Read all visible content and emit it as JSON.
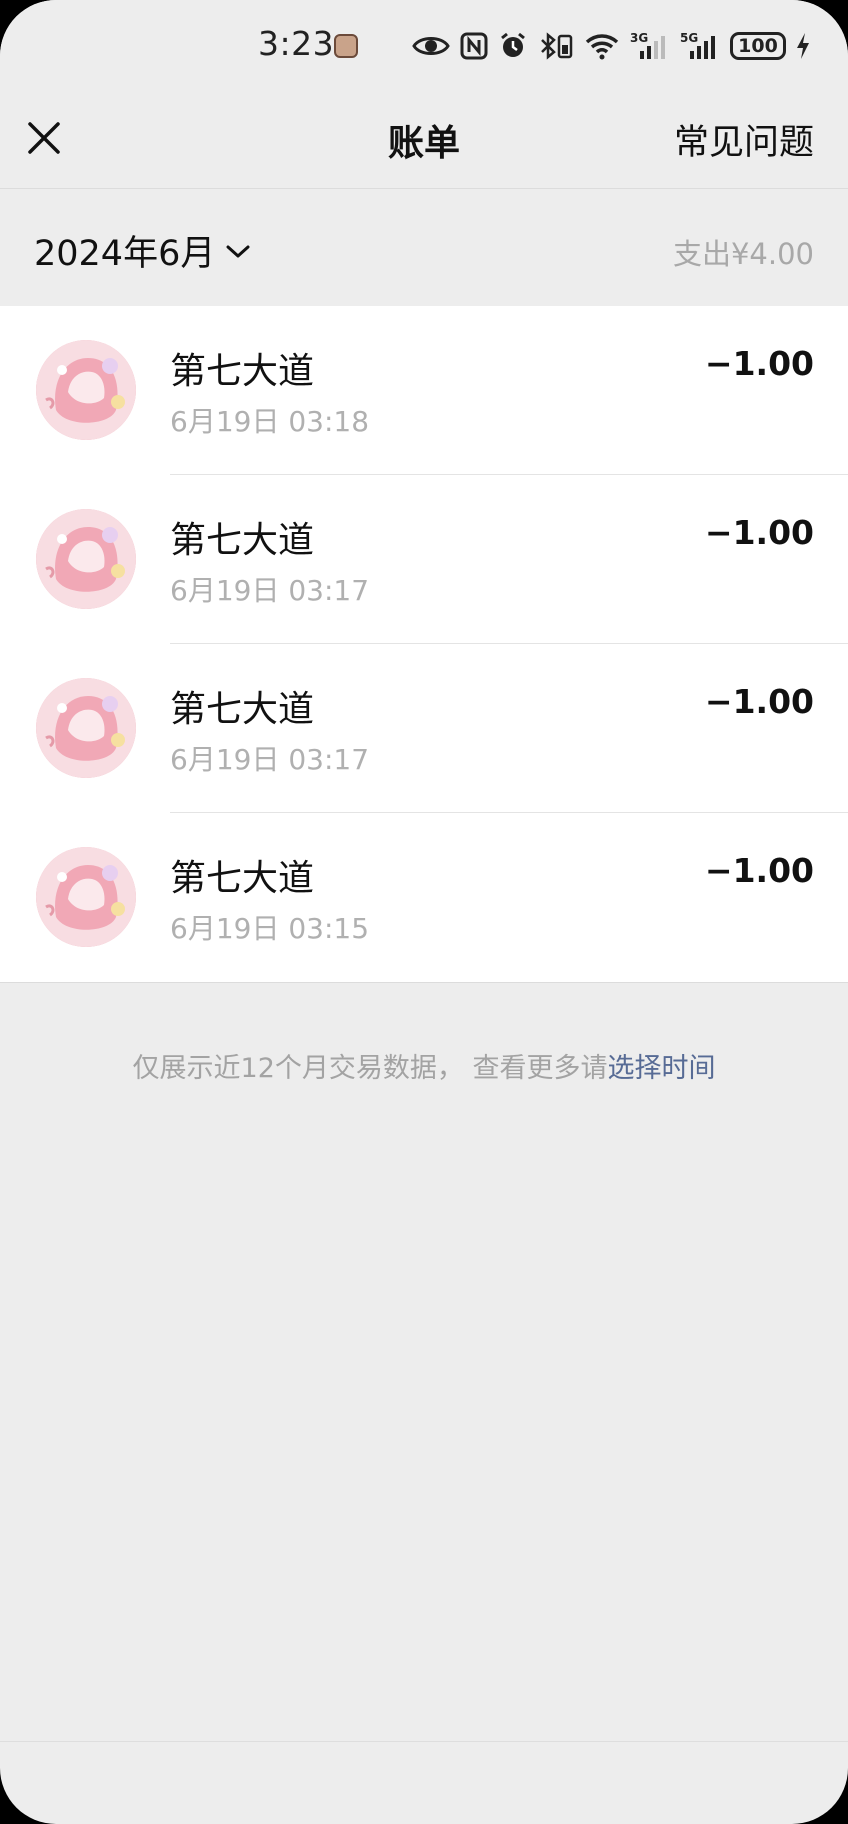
{
  "status_bar": {
    "time": "3:23",
    "battery": "100",
    "icons": [
      "app-icon",
      "eye-icon",
      "nfc-icon",
      "alarm-icon",
      "bluetooth-icon",
      "wifi-icon",
      "signal-3g-icon",
      "signal-5g-icon",
      "battery-icon",
      "charging-icon"
    ],
    "network_1": "3G",
    "network_2": "5G"
  },
  "nav": {
    "title": "账单",
    "faq_label": "常见问题",
    "close_icon": "close-icon"
  },
  "month_header": {
    "month": "2024年6月",
    "total_label": "支出",
    "total_amount": "¥4.00",
    "dropdown_icon": "chevron-down-icon"
  },
  "bills": [
    {
      "merchant": "第七大道",
      "time": "6月19日 03:18",
      "amount": "−1.00"
    },
    {
      "merchant": "第七大道",
      "time": "6月19日 03:17",
      "amount": "−1.00"
    },
    {
      "merchant": "第七大道",
      "time": "6月19日 03:17",
      "amount": "−1.00"
    },
    {
      "merchant": "第七大道",
      "time": "6月19日 03:15",
      "amount": "−1.00"
    }
  ],
  "footer": {
    "note_text": "仅展示近12个月交易数据， 查看更多请",
    "note_link": "选择时间"
  },
  "colors": {
    "background": "#ededed",
    "link": "#576b95",
    "secondary_text": "#a8a8a8"
  }
}
